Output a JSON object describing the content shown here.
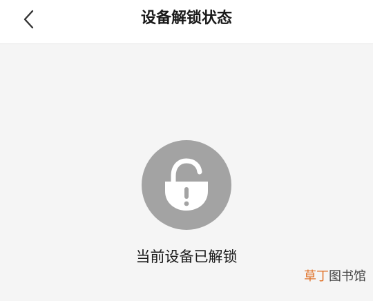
{
  "header": {
    "title": "设备解锁状态",
    "back_icon": "chevron-left-icon"
  },
  "status": {
    "icon": "unlocked-padlock-icon",
    "message": "当前设备已解锁"
  },
  "watermark": {
    "accent": "草丁",
    "rest": "图书馆"
  },
  "colors": {
    "background": "#f5f5f5",
    "header_background": "#ffffff",
    "icon_circle": "#a3a3a3",
    "watermark_accent": "#e0732b"
  }
}
